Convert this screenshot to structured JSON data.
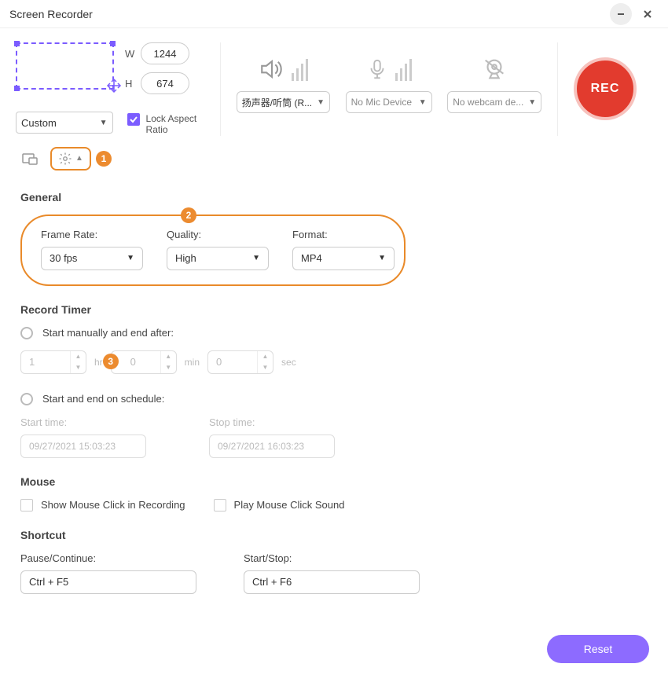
{
  "window": {
    "title": "Screen Recorder"
  },
  "region": {
    "mode": "Custom",
    "width": "1244",
    "height": "674",
    "w_label": "W",
    "h_label": "H",
    "lock_label": "Lock Aspect Ratio",
    "lock_checked": true
  },
  "devices": {
    "speaker": {
      "selected": "扬声器/听筒 (R..."
    },
    "mic": {
      "selected": "No Mic Device"
    },
    "webcam": {
      "selected": "No webcam de..."
    }
  },
  "rec_button": "REC",
  "step_badges": {
    "one": "1",
    "two": "2",
    "three": "3"
  },
  "general": {
    "title": "General",
    "frame_rate_label": "Frame Rate:",
    "frame_rate_value": "30 fps",
    "quality_label": "Quality:",
    "quality_value": "High",
    "format_label": "Format:",
    "format_value": "MP4"
  },
  "timer": {
    "title": "Record Timer",
    "manual_label": "Start manually and end after:",
    "hr_value": "1",
    "hr_unit": "hr",
    "min_value": "0",
    "min_unit": "min",
    "sec_value": "0",
    "sec_unit": "sec",
    "schedule_label": "Start and end on schedule:",
    "start_label": "Start time:",
    "start_value": "09/27/2021 15:03:23",
    "stop_label": "Stop time:",
    "stop_value": "09/27/2021 16:03:23"
  },
  "mouse": {
    "title": "Mouse",
    "show_click": "Show Mouse Click in Recording",
    "play_sound": "Play Mouse Click Sound"
  },
  "shortcut": {
    "title": "Shortcut",
    "pause_label": "Pause/Continue:",
    "pause_value": "Ctrl + F5",
    "start_label": "Start/Stop:",
    "start_value": "Ctrl + F6"
  },
  "footer": {
    "reset": "Reset"
  }
}
